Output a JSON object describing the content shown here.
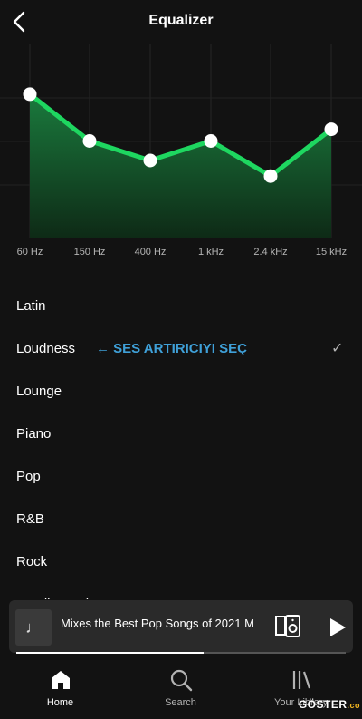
{
  "header": {
    "title": "Equalizer",
    "back_icon": "chevron-left-icon"
  },
  "equalizer": {
    "bands": [
      "60 Hz",
      "150 Hz",
      "400 Hz",
      "1 kHz",
      "2.4 kHz",
      "15 kHz"
    ],
    "levels": [
      0.74,
      0.5,
      0.4,
      0.5,
      0.32,
      0.56
    ],
    "accent": "#1ed760",
    "fill_top": "#1a7a3d",
    "fill_bottom": "#0e2a16"
  },
  "presets": [
    {
      "label": "Latin"
    },
    {
      "label": "Loudness",
      "hint": "← SES ARTIRICIYI SEÇ",
      "check": "✓"
    },
    {
      "label": "Lounge"
    },
    {
      "label": "Piano"
    },
    {
      "label": "Pop"
    },
    {
      "label": "R&B"
    },
    {
      "label": "Rock"
    },
    {
      "label": "Small Speakers"
    }
  ],
  "now_playing": {
    "track": "Mixes the Best Pop Songs of 2021 M",
    "progress": 0.57,
    "art_icon": "music-note-icon"
  },
  "nav": [
    {
      "label": "Home",
      "icon": "home-icon",
      "active": true
    },
    {
      "label": "Search",
      "icon": "search-icon",
      "active": false
    },
    {
      "label": "Your Library",
      "icon": "library-icon",
      "active": false
    }
  ],
  "watermark": {
    "text": "GÖSTER",
    "suffix": ".co"
  }
}
